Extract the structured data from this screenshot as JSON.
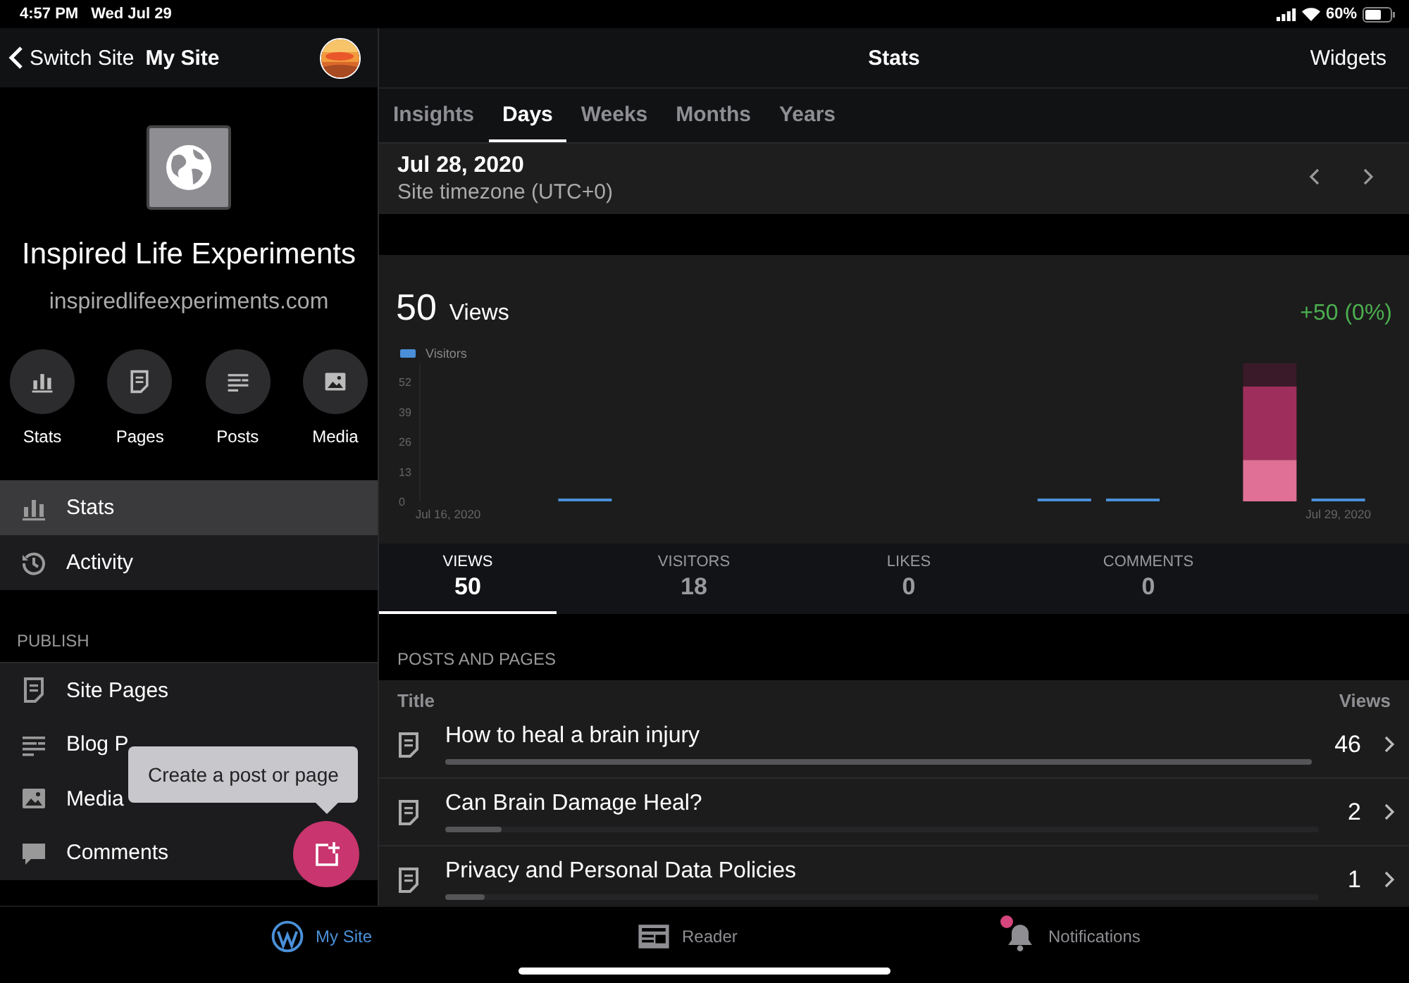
{
  "status_bar": {
    "time": "4:57 PM",
    "date": "Wed Jul 29",
    "battery": "60%"
  },
  "sidebar": {
    "back_label": "Switch Site",
    "title": "My Site",
    "site_name": "Inspired Life Experiments",
    "site_url": "inspiredlifeexperiments.com",
    "quick_actions": [
      {
        "label": "Stats",
        "kind": "stats"
      },
      {
        "label": "Pages",
        "kind": "pages"
      },
      {
        "label": "Posts",
        "kind": "posts"
      },
      {
        "label": "Media",
        "kind": "media"
      }
    ],
    "menu": [
      {
        "label": "Stats",
        "kind": "stats",
        "selected": true
      },
      {
        "label": "Activity",
        "kind": "activity",
        "selected": false
      }
    ],
    "publish": {
      "heading": "PUBLISH",
      "items": [
        {
          "label": "Site Pages",
          "kind": "pages"
        },
        {
          "label": "Blog P",
          "kind": "posts"
        },
        {
          "label": "Media",
          "kind": "media"
        },
        {
          "label": "Comments",
          "kind": "comments"
        }
      ]
    },
    "tooltip": "Create a post or page"
  },
  "stats": {
    "title": "Stats",
    "widgets_button": "Widgets",
    "tabs": [
      {
        "label": "Insights",
        "selected": false
      },
      {
        "label": "Days",
        "selected": true
      },
      {
        "label": "Weeks",
        "selected": false
      },
      {
        "label": "Months",
        "selected": false
      },
      {
        "label": "Years",
        "selected": false
      }
    ],
    "date": "Jul 28, 2020",
    "timezone": "Site timezone (UTC+0)",
    "views_count": "50",
    "views_label": "Views",
    "change": "+50 (0%)",
    "chart": {
      "chart_data": {
        "type": "bar",
        "categories": [
          "Jul 16, 2020",
          null,
          null,
          null,
          null,
          null,
          null,
          null,
          null,
          null,
          null,
          null,
          null,
          "Jul 29, 2020"
        ],
        "ylim": [
          0,
          60
        ],
        "yticks": [
          0,
          13,
          26,
          39,
          52
        ],
        "stacked": true,
        "series": [
          {
            "name": "Visitors",
            "color": "#4a8fd8",
            "values": [
              0,
              0,
              1,
              0,
              0,
              0,
              0,
              0,
              0,
              1,
              1,
              0,
              0,
              1
            ]
          },
          {
            "color": "#e07095",
            "values": [
              0,
              0,
              0,
              0,
              0,
              0,
              0,
              0,
              0,
              0,
              0,
              0,
              18,
              0
            ]
          },
          {
            "color": "#9e2f5c",
            "values": [
              0,
              0,
              0,
              0,
              0,
              0,
              0,
              0,
              0,
              0,
              0,
              0,
              32,
              0
            ]
          },
          {
            "color": "#3a1a28",
            "values": [
              0,
              0,
              0,
              0,
              0,
              0,
              0,
              0,
              0,
              0,
              0,
              0,
              10,
              0
            ]
          }
        ]
      }
    },
    "summary": [
      {
        "label": "VIEWS",
        "value": "50",
        "selected": true
      },
      {
        "label": "VISITORS",
        "value": "18",
        "selected": false
      },
      {
        "label": "LIKES",
        "value": "0",
        "selected": false
      },
      {
        "label": "COMMENTS",
        "value": "0",
        "selected": false
      }
    ],
    "posts_heading": "POSTS AND PAGES",
    "columns": [
      "Title",
      "Views"
    ],
    "rows": [
      {
        "title": "How to heal a brain injury",
        "views": "46",
        "level": 1
      },
      {
        "title": "Can Brain Damage Heal?",
        "views": "2",
        "level": 0.065
      },
      {
        "title": "Privacy and Personal Data Policies",
        "views": "1",
        "level": 0.045
      }
    ]
  },
  "tab_bar": [
    {
      "label": "My Site",
      "kind": "mysite",
      "selected": true,
      "unread": false
    },
    {
      "label": "Reader",
      "kind": "reader",
      "selected": false,
      "unread": false
    },
    {
      "label": "Notifications",
      "kind": "notifications",
      "selected": false,
      "unread": true
    }
  ]
}
